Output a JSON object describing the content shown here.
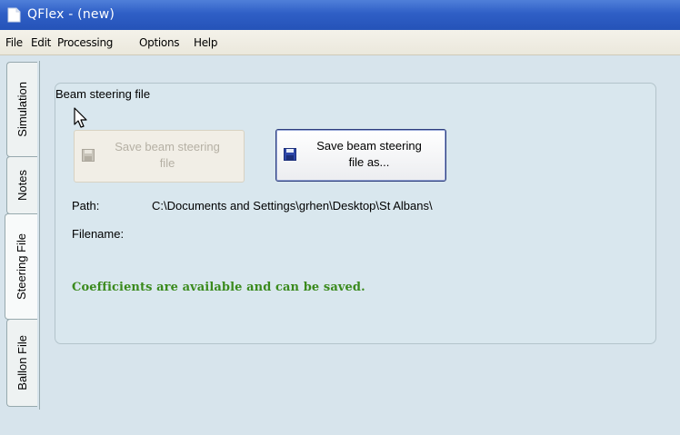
{
  "window": {
    "title": "QFlex - (new)"
  },
  "menu": [
    "File",
    "Edit",
    "Processing",
    "Options",
    "Help"
  ],
  "tabs": [
    {
      "label": "Simulation",
      "active": false
    },
    {
      "label": "Notes",
      "active": false
    },
    {
      "label": "Steering File",
      "active": true
    },
    {
      "label": "Ballon File",
      "active": false
    }
  ],
  "steering": {
    "group_title": "Beam steering file",
    "save_button": {
      "line1": "Save beam steering",
      "line2": "file",
      "enabled": false,
      "icon": "floppy-disk-icon"
    },
    "save_as_button": {
      "line1": "Save beam steering",
      "line2": "file as...",
      "enabled": true,
      "icon": "floppy-disk-icon"
    },
    "path_label": "Path:",
    "path_value": "C:\\Documents and Settings\\grhen\\Desktop\\St Albans\\",
    "filename_label": "Filename:",
    "filename_value": "",
    "status_message": "Coefficients are available and can be saved."
  },
  "colors": {
    "titlebar": "#2553b8",
    "status_text": "#3a8a1c",
    "panel": "#d7e4ec"
  }
}
